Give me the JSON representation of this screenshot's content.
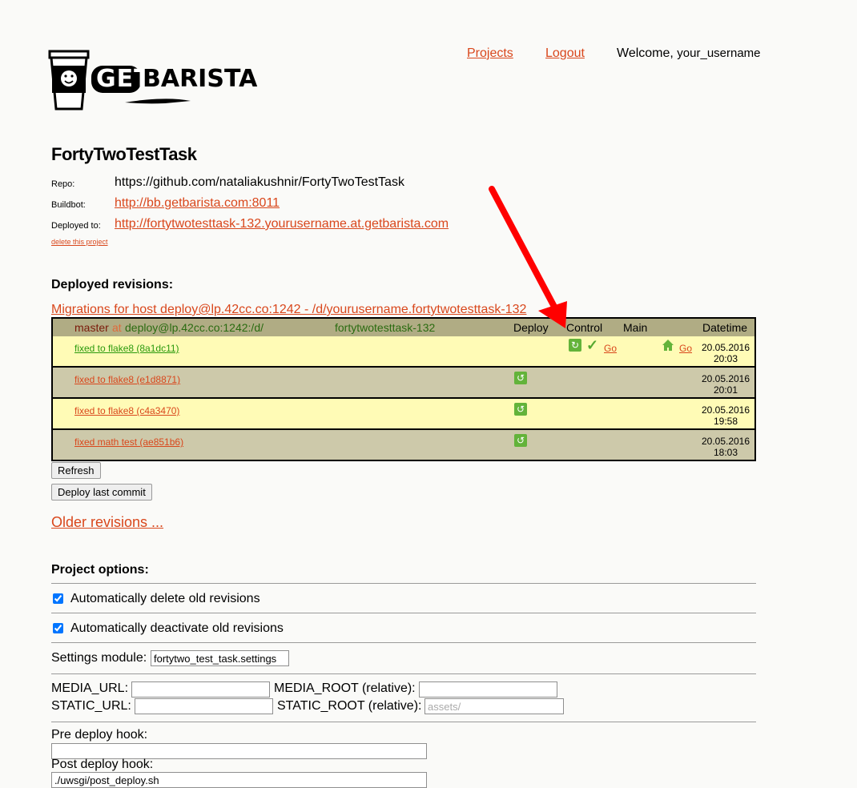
{
  "header": {
    "brand_left": "GET",
    "brand_right": "BARISTA",
    "nav": {
      "projects": "Projects",
      "logout": "Logout"
    },
    "welcome_label": "Welcome,",
    "username": "your_username"
  },
  "project": {
    "title": "FortyTwoTestTask",
    "repo_label": "Repo:",
    "repo_value": "https://github.com/nataliakushnir/FortyTwoTestTask",
    "buildbot_label": "Buildbot:",
    "buildbot_value": "http://bb.getbarista.com:8011",
    "deployed_label": "Deployed to:",
    "deployed_value": "http://fortytwotesttask-132.yourusername.at.getbarista.com",
    "delete_link": "delete this project"
  },
  "deployed": {
    "heading": "Deployed revisions:",
    "migrations_link": "Migrations for host deploy@lp.42cc.co:1242 - /d/yourusername.fortytwotesttask-132",
    "table_header": {
      "branch": "master",
      "at": "at",
      "host_path": "deploy@lp.42cc.co:1242:/d/",
      "host_suffix": "fortytwotesttask-132",
      "col_deploy": "Deploy",
      "col_control": "Control",
      "col_main": "Main",
      "col_datetime": "Datetime"
    },
    "rows": [
      {
        "commit": "fixed to flake8 (8a1dc11)",
        "date": "20.05.2016",
        "time": "20:03",
        "go_control": "Go",
        "go_main": "Go"
      },
      {
        "commit": "fixed to flake8 (e1d8871)",
        "date": "20.05.2016",
        "time": "20:01"
      },
      {
        "commit": "fixed to flake8 (c4a3470)",
        "date": "20.05.2016",
        "time": "19:58"
      },
      {
        "commit": "fixed math test (ae851b6)",
        "date": "20.05.2016",
        "time": "18:03"
      }
    ],
    "refresh_button": "Refresh",
    "deploy_last_button": "Deploy last commit",
    "older_link": "Older revisions ..."
  },
  "options": {
    "heading": "Project options:",
    "auto_delete_label": "Automatically delete old revisions",
    "auto_delete_checked": true,
    "auto_deactivate_label": "Automatically deactivate old revisions",
    "auto_deactivate_checked": true,
    "settings_module_label": "Settings module:",
    "settings_module_value": "fortytwo_test_task.settings",
    "media_url_label": "MEDIA_URL:",
    "media_url_value": "",
    "media_root_label": "MEDIA_ROOT (relative):",
    "media_root_value": "",
    "static_url_label": "STATIC_URL:",
    "static_url_value": "",
    "static_root_label": "STATIC_ROOT (relative):",
    "static_root_placeholder": "assets/",
    "pre_deploy_label": "Pre deploy hook:",
    "pre_deploy_value": "",
    "post_deploy_label": "Post deploy hook:",
    "post_deploy_value": "./uwsgi/post_deploy.sh"
  },
  "colors": {
    "link": "#d9471c",
    "row_yellow": "#fffbb6",
    "row_grey": "#cdc9aa",
    "header_olive": "#b0ac84",
    "active_green": "#2a9a0c",
    "icon_green": "#63b33a",
    "arrow_red": "#ff0000"
  }
}
